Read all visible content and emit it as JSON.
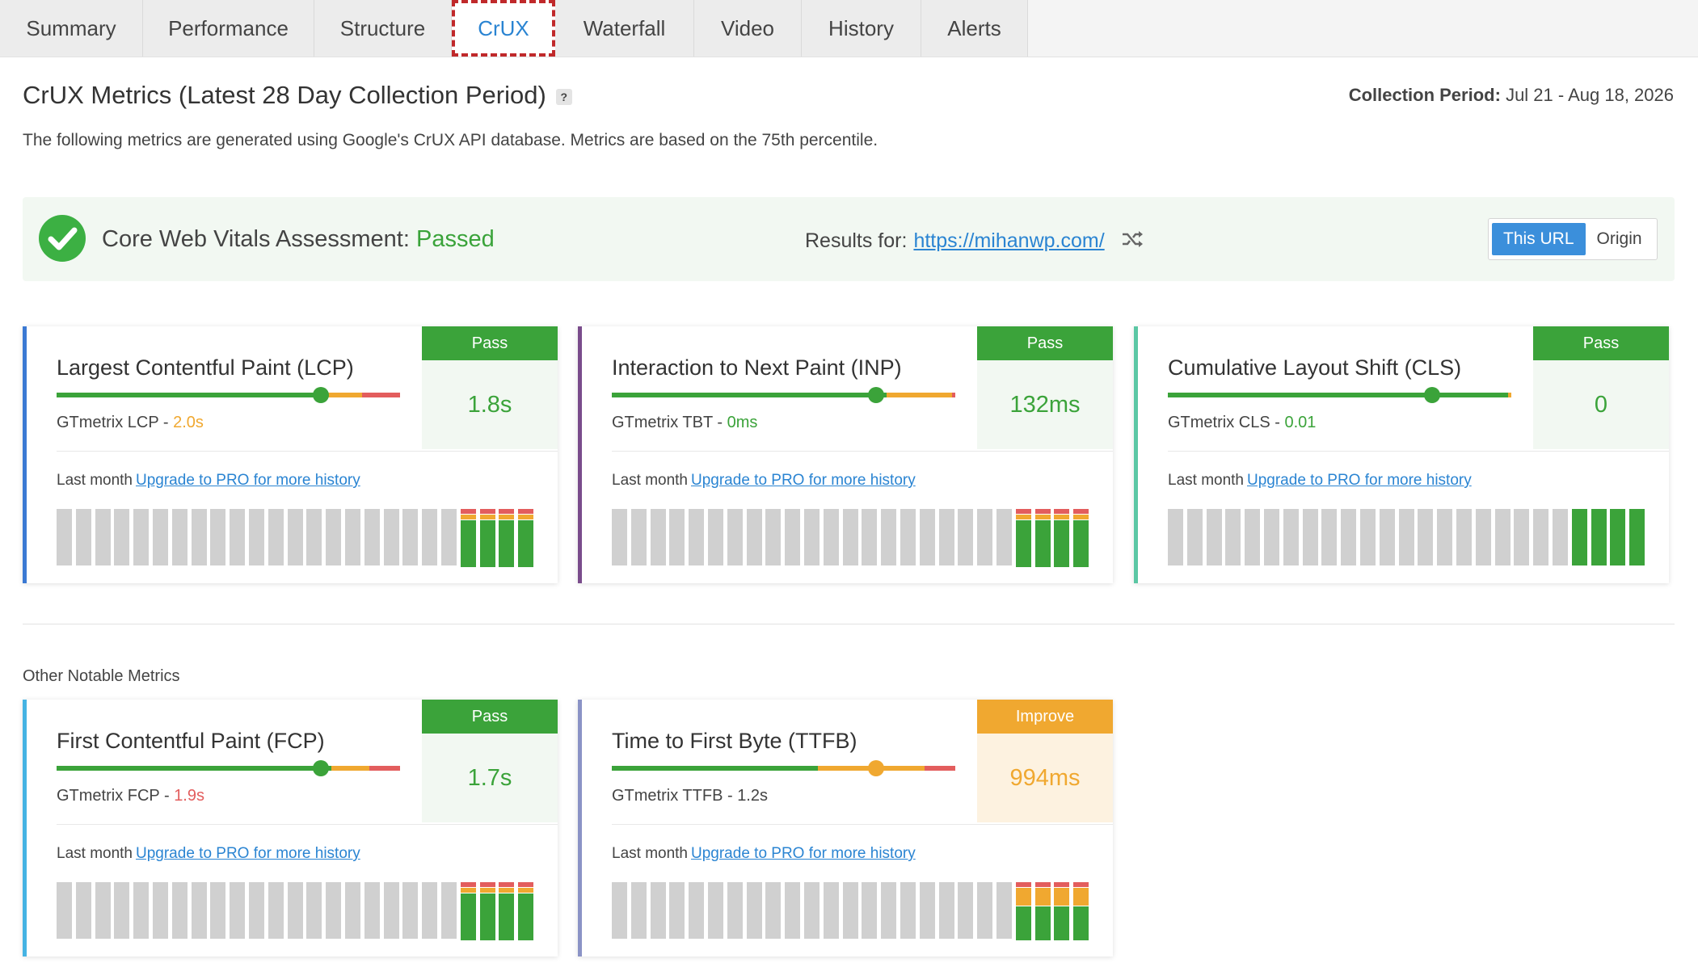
{
  "tabs": [
    {
      "label": "Summary",
      "active": false
    },
    {
      "label": "Performance",
      "active": false
    },
    {
      "label": "Structure",
      "active": false
    },
    {
      "label": "CrUX",
      "active": true
    },
    {
      "label": "Waterfall",
      "active": false
    },
    {
      "label": "Video",
      "active": false
    },
    {
      "label": "History",
      "active": false
    },
    {
      "label": "Alerts",
      "active": false
    }
  ],
  "header": {
    "title": "CrUX Metrics (Latest 28 Day Collection Period)",
    "help": "?",
    "collection_label": "Collection Period:",
    "collection_value": "Jul 21 - Aug 18, 2026",
    "subtitle": "The following metrics are generated using Google's CrUX API database. Metrics are based on the 75th percentile."
  },
  "assessment": {
    "label": "Core Web Vitals Assessment:",
    "status": "Passed",
    "results_label": "Results for:",
    "url": "https://mihanwp.com/",
    "toggle": {
      "this_url": "This URL",
      "origin": "Origin"
    }
  },
  "colors": {
    "pass": "#3ba33a",
    "improve": "#f0a830",
    "poor": "#e35d5d",
    "grey": "#d0d0d0"
  },
  "metrics": [
    {
      "name": "Largest Contentful Paint (LCP)",
      "accent": "#3b79d3",
      "badge": "Pass",
      "badge_color": "#3ba33a",
      "value": "1.8s",
      "value_color": "#3ba33a",
      "valbox_bg": "#f2f8f2",
      "bar": [
        0.75,
        0.14,
        0.11
      ],
      "marker": 0.77,
      "marker_color": "#3ba33a",
      "gt_label": "GTmetrix LCP - ",
      "gt_value": "2.0s",
      "gt_color": "#f0a830",
      "last_month": "Last month",
      "upgrade": "Upgrade to PRO for more history",
      "history": [
        4,
        4,
        4,
        4
      ]
    },
    {
      "name": "Interaction to Next Paint (INP)",
      "accent": "#7a4c8c",
      "badge": "Pass",
      "badge_color": "#3ba33a",
      "value": "132ms",
      "value_color": "#3ba33a",
      "valbox_bg": "#f2f8f2",
      "bar": [
        0.8,
        0.19,
        0.01
      ],
      "marker": 0.77,
      "marker_color": "#3ba33a",
      "gt_label": "GTmetrix TBT - ",
      "gt_value": "0ms",
      "gt_color": "#3ba33a",
      "last_month": "Last month",
      "upgrade": "Upgrade to PRO for more history",
      "history": [
        4,
        4,
        4,
        4
      ]
    },
    {
      "name": "Cumulative Layout Shift (CLS)",
      "accent": "#5bc7a4",
      "badge": "Pass",
      "badge_color": "#3ba33a",
      "value": "0",
      "value_color": "#3ba33a",
      "valbox_bg": "#f2f8f2",
      "bar": [
        0.99,
        0.01,
        0.0
      ],
      "marker": 0.77,
      "marker_color": "#3ba33a",
      "gt_label": "GTmetrix CLS - ",
      "gt_value": "0.01",
      "gt_color": "#3ba33a",
      "last_month": "Last month",
      "upgrade": "Upgrade to PRO for more history",
      "history": [
        4,
        4,
        4,
        4
      ]
    }
  ],
  "other": {
    "title": "Other Notable Metrics",
    "metrics": [
      {
        "name": "First Contentful Paint (FCP)",
        "accent": "#45b3e3",
        "badge": "Pass",
        "badge_color": "#3ba33a",
        "value": "1.7s",
        "value_color": "#3ba33a",
        "valbox_bg": "#f2f8f2",
        "bar": [
          0.8,
          0.11,
          0.09
        ],
        "marker": 0.77,
        "marker_color": "#3ba33a",
        "gt_label": "GTmetrix FCP - ",
        "gt_value": "1.9s",
        "gt_color": "#e35d5d",
        "last_month": "Last month",
        "upgrade": "Upgrade to PRO for more history",
        "history": [
          4,
          4,
          4,
          4
        ]
      },
      {
        "name": "Time to First Byte (TTFB)",
        "accent": "#8b93c6",
        "badge": "Improve",
        "badge_color": "#f0a830",
        "value": "994ms",
        "value_color": "#f0a830",
        "valbox_bg": "#fdf2e0",
        "bar": [
          0.6,
          0.31,
          0.09
        ],
        "marker": 0.77,
        "marker_color": "#f0a830",
        "gt_label": "GTmetrix TTFB - ",
        "gt_value": "1.2s",
        "gt_color": "#444444",
        "last_month": "Last month",
        "upgrade": "Upgrade to PRO for more history",
        "history": [
          4,
          4,
          4,
          4
        ]
      }
    ]
  }
}
